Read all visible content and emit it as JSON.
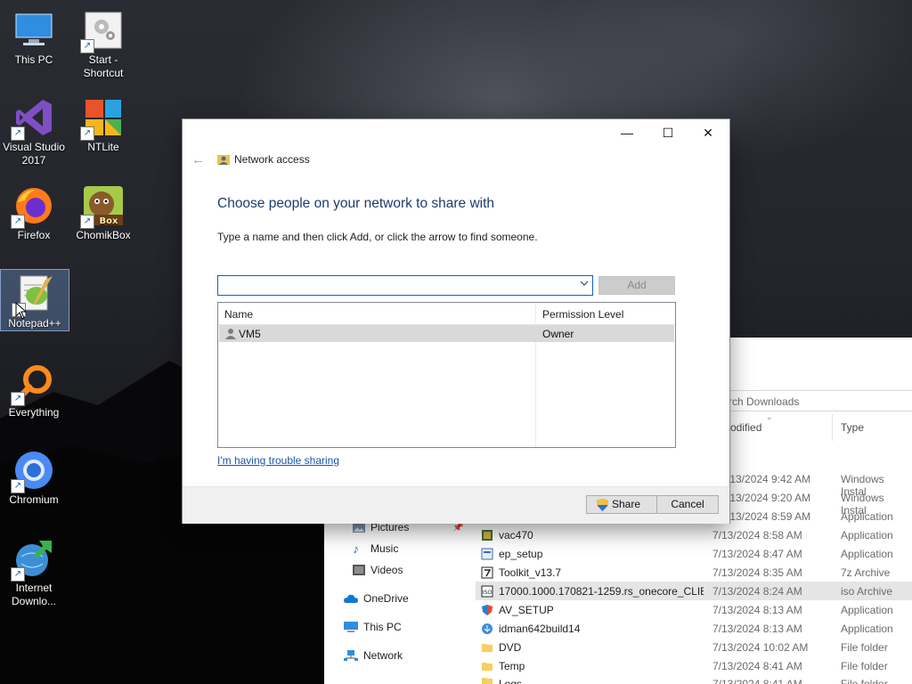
{
  "desktop": {
    "icons": [
      {
        "label": "This PC"
      },
      {
        "label": "Start - Shortcut"
      },
      {
        "label": "Visual Studio 2017"
      },
      {
        "label": "NTLite"
      },
      {
        "label": "Firefox"
      },
      {
        "label": "ChomikBox"
      },
      {
        "label": "Notepad++"
      },
      {
        "label": "Everything"
      },
      {
        "label": "Chromium"
      },
      {
        "label": "Internet Downlo..."
      }
    ],
    "chomikbox_logo_text": "Box"
  },
  "dialog": {
    "title": "Network access",
    "heading": "Choose people on your network to share with",
    "instruction": "Type a name and then click Add, or click the arrow to find someone.",
    "name_input": {
      "value": "",
      "placeholder": ""
    },
    "add_label": "Add",
    "columns": {
      "name": "Name",
      "permission": "Permission Level"
    },
    "rows": [
      {
        "name": "VM5",
        "permission": "Owner"
      }
    ],
    "trouble_link": "I'm having trouble sharing",
    "share_label": "Share",
    "cancel_label": "Cancel",
    "titlebar_buttons": {
      "minimize": "—",
      "maximize": "☐",
      "close": "✕"
    }
  },
  "explorer": {
    "search_placeholder": "rch Downloads",
    "col_modified": "e modified",
    "col_type": "Type",
    "nav": [
      {
        "label": "Pictures"
      },
      {
        "label": "Music"
      },
      {
        "label": "Videos"
      },
      {
        "label": "OneDrive"
      },
      {
        "label": "This PC"
      },
      {
        "label": "Network"
      }
    ],
    "partial_rows": [
      {
        "date": "/13/2024 9:42 AM",
        "type": "Windows Instal"
      },
      {
        "date": "/13/2024 9:20 AM",
        "type": "Windows Instal"
      },
      {
        "date": "/13/2024 8:59 AM",
        "type": "Application"
      }
    ],
    "files": [
      {
        "name": "vac470",
        "date": "7/13/2024 8:58 AM",
        "type": "Application"
      },
      {
        "name": "ep_setup",
        "date": "7/13/2024 8:47 AM",
        "type": "Application"
      },
      {
        "name": "Toolkit_v13.7",
        "date": "7/13/2024 8:35 AM",
        "type": "7z Archive"
      },
      {
        "name": "17000.1000.170821-1259.rs_onecore_CLIE...",
        "date": "7/13/2024 8:24 AM",
        "type": "iso Archive"
      },
      {
        "name": "AV_SETUP",
        "date": "7/13/2024 8:13 AM",
        "type": "Application"
      },
      {
        "name": "idman642build14",
        "date": "7/13/2024 8:13 AM",
        "type": "Application"
      },
      {
        "name": "DVD",
        "date": "7/13/2024 10:02 AM",
        "type": "File folder"
      },
      {
        "name": "Temp",
        "date": "7/13/2024 8:41 AM",
        "type": "File folder"
      },
      {
        "name": "Logs",
        "date": "7/13/2024 8:41 AM",
        "type": "File folder"
      }
    ]
  },
  "colors": {
    "heading": "#1e3b70",
    "link": "#1a56a8",
    "focus_border": "#0a64c2",
    "selected_row": "#d9d9d9"
  }
}
